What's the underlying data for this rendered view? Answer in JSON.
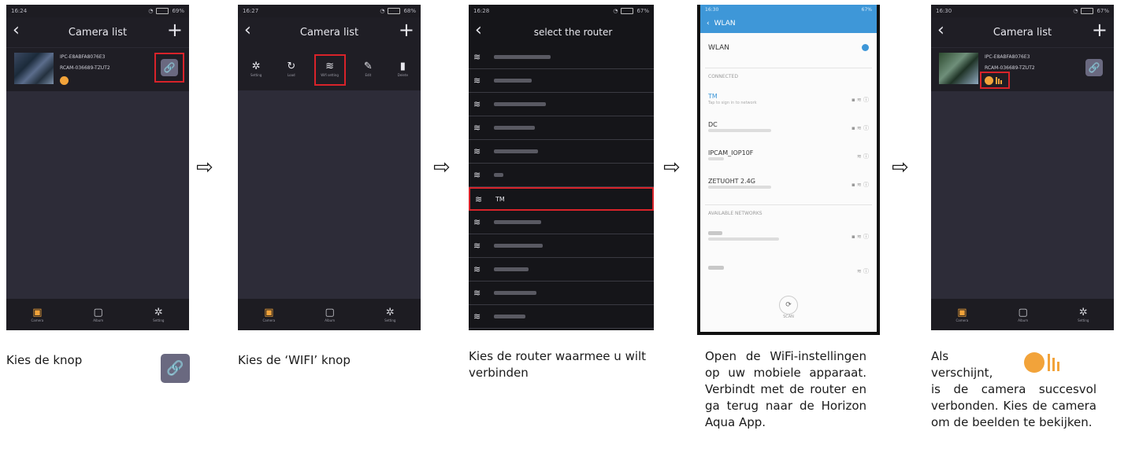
{
  "phone1": {
    "status_time": "16:24",
    "status_battery": "69%",
    "title": "Camera list",
    "back_icon": "‹",
    "add_icon": "+",
    "camera": {
      "id": "IPC-E8ABFA8076E3",
      "name": "RCAM-036689-TZUT2"
    },
    "tabs": [
      {
        "label": "Camera"
      },
      {
        "label": "Album"
      },
      {
        "label": "Setting"
      }
    ]
  },
  "phone2": {
    "status_time": "16:27",
    "status_battery": "68%",
    "title": "Camera list",
    "tools": [
      {
        "icon": "gear-icon",
        "label": "Setting"
      },
      {
        "icon": "refresh-icon",
        "label": "Load"
      },
      {
        "icon": "wifi-icon",
        "label": "Wifi setting"
      },
      {
        "icon": "edit-icon",
        "label": "Edit"
      },
      {
        "icon": "trash-icon",
        "label": "Delete"
      }
    ],
    "tabs": [
      {
        "label": "Camera"
      },
      {
        "label": "Album"
      },
      {
        "label": "Setting"
      }
    ]
  },
  "phone3": {
    "status_time": "16:28",
    "status_battery": "67%",
    "title": "select the router",
    "selected_network": "TM"
  },
  "phone4": {
    "status_time": "16:30",
    "status_battery": "67%",
    "header": "WLAN",
    "wlan_label": "WLAN",
    "connected_header": "CONNECTED",
    "tm_name": "TM",
    "tm_sub": "Tap to sign in to network",
    "dc_name": "DC",
    "ipcam_name": "IPCAM_IOP10F",
    "zetuoht_name": "ZETUOHT 2.4G",
    "available_header": "AVAILABLE NETWORKS",
    "scan_label": "SCAN"
  },
  "phone5": {
    "status_time": "16:30",
    "status_battery": "67%",
    "title": "Camera list",
    "camera": {
      "id": "IPC-E8ABFA8076E3",
      "name": "RCAM-036689-TZUT2"
    },
    "tabs": [
      {
        "label": "Camera"
      },
      {
        "label": "Album"
      },
      {
        "label": "Setting"
      }
    ]
  },
  "captions": {
    "c1": "Kies de knop",
    "c2": "Kies de ‘WIFI’ knop",
    "c3": "Kies de router waarmee u wilt verbinden",
    "c4": "Open de WiFi-instellingen op uw mobiele apparaat. Verbindt met de router en ga terug naar de Horizon Aqua App.",
    "c5_a": "Als",
    "c5_b": "verschijnt,",
    "c5_c": "is de camera succesvol verbonden. Kies de camera om de beelden te bekijken."
  },
  "arrow_icon": "⇨",
  "colors": {
    "accent_orange": "#f2a33a",
    "highlight_red": "#d8232a",
    "app_bg": "#2d2c38",
    "wlan_blue": "#3e97d8"
  }
}
